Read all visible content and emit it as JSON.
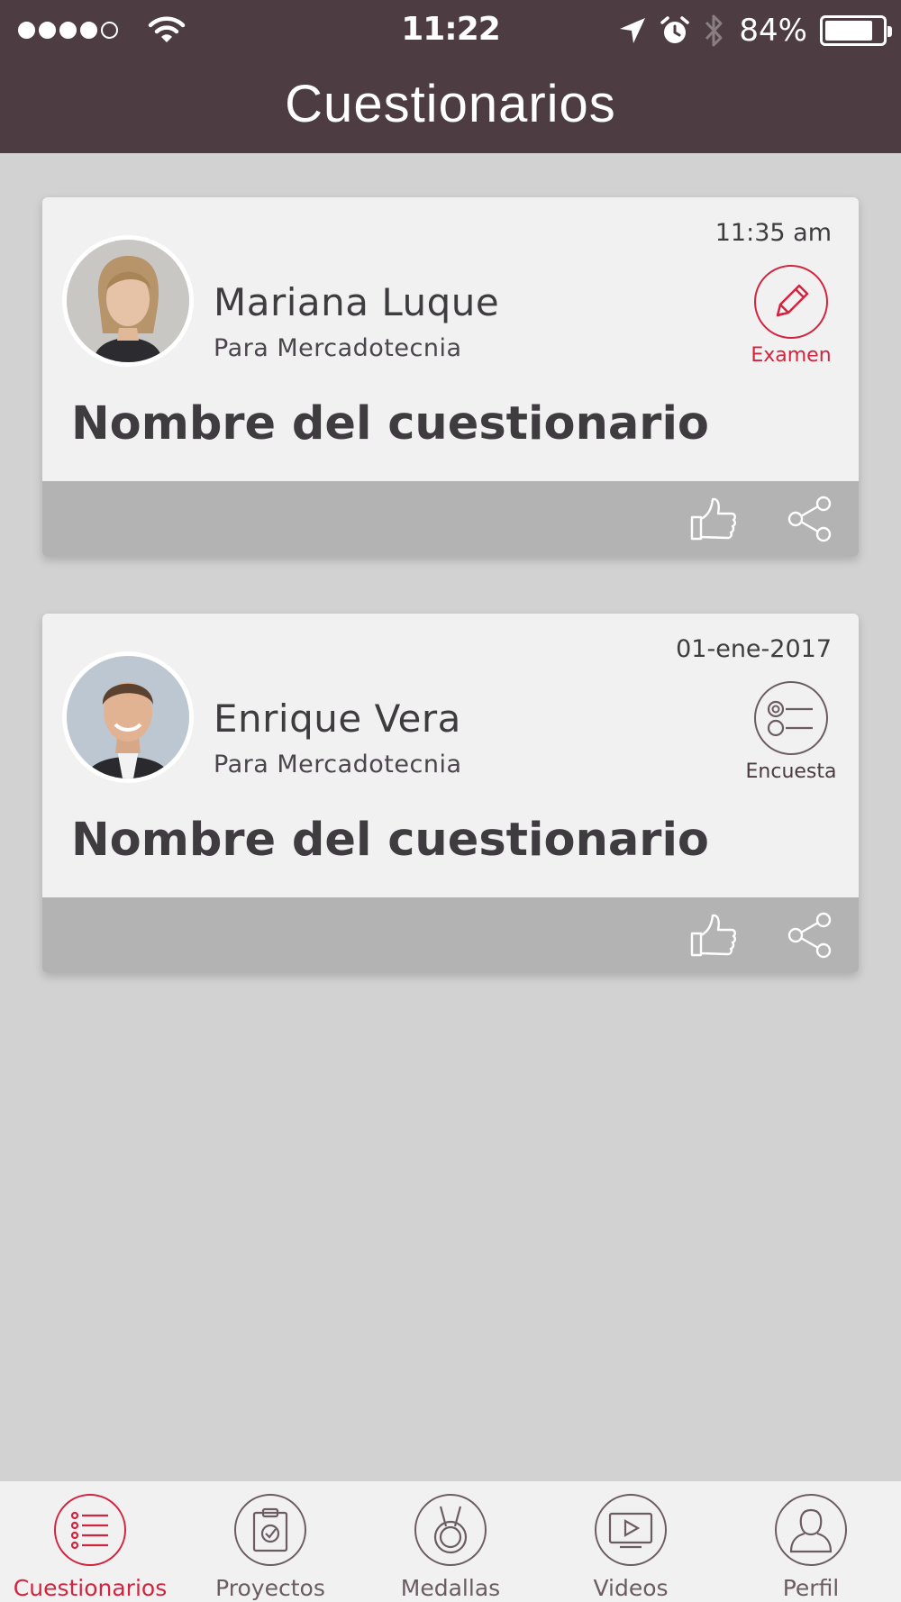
{
  "status_bar": {
    "time": "11:22",
    "battery_percent": "84%",
    "signal_bars_filled": 4,
    "signal_bars_total": 5,
    "battery_level": 0.84
  },
  "header": {
    "title": "Cuestionarios"
  },
  "colors": {
    "header_bg": "#4d3d43",
    "accent": "#d3243f",
    "card_bg": "#f1f1f1",
    "footer_bg": "#b3b3b3",
    "page_bg": "#d2d2d2"
  },
  "cards": [
    {
      "date": "11:35 am",
      "author": "Mariana Luque",
      "department": "Para Mercadotecnia",
      "type_label": "Examen",
      "type_icon": "pencil-icon",
      "name": "Nombre del cuestionario"
    },
    {
      "date": "01-ene-2017",
      "author": "Enrique Vera",
      "department": "Para Mercadotecnia",
      "type_label": "Encuesta",
      "type_icon": "survey-list-icon",
      "name": "Nombre del cuestionario"
    }
  ],
  "bottom_nav": [
    {
      "label": "Cuestionarios",
      "icon": "list-icon",
      "active": true
    },
    {
      "label": "Proyectos",
      "icon": "clipboard-check-icon",
      "active": false
    },
    {
      "label": "Medallas",
      "icon": "medal-icon",
      "active": false
    },
    {
      "label": "Videos",
      "icon": "play-icon",
      "active": false
    },
    {
      "label": "Perfil",
      "icon": "user-icon",
      "active": false
    }
  ]
}
